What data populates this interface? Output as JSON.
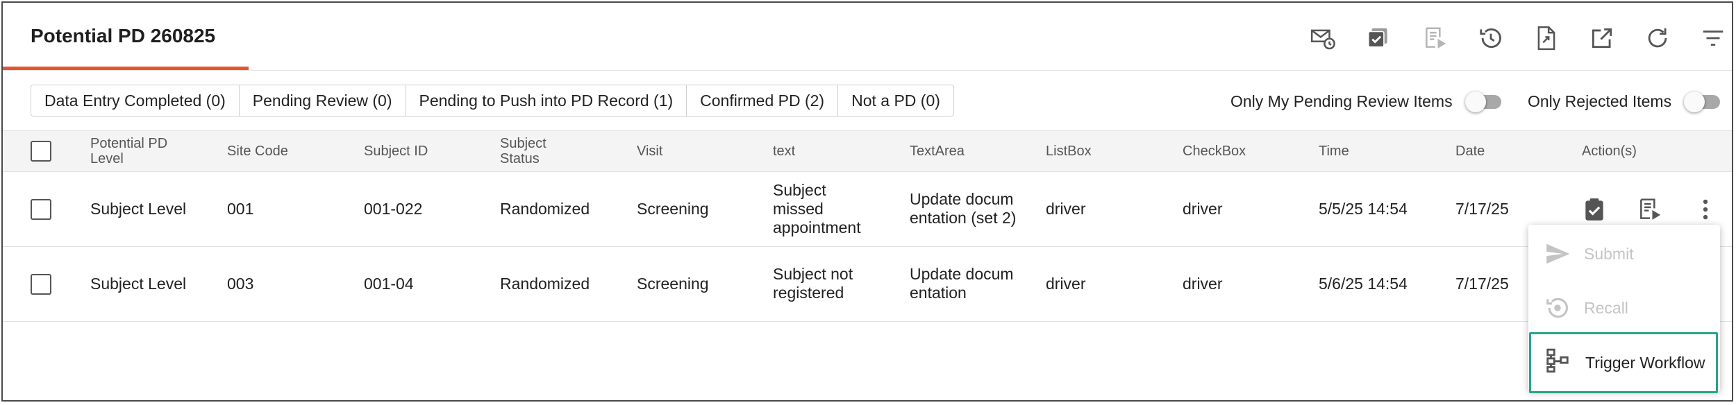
{
  "header": {
    "title": "Potential PD 260825",
    "tools": [
      {
        "icon": "email-schedule-icon"
      },
      {
        "icon": "bulk-approve-icon"
      },
      {
        "icon": "review-submit-icon"
      },
      {
        "icon": "history-icon"
      },
      {
        "icon": "export-document-icon"
      },
      {
        "icon": "open-external-icon"
      },
      {
        "icon": "refresh-icon"
      },
      {
        "icon": "filter-icon"
      }
    ]
  },
  "filters": {
    "segments": [
      "Data Entry Completed (0)",
      "Pending Review (0)",
      "Pending to Push into PD Record (1)",
      "Confirmed PD (2)",
      "Not a PD (0)"
    ],
    "toggle_my_pending": "Only My Pending Review Items",
    "toggle_rejected": "Only Rejected Items"
  },
  "table": {
    "columns": [
      "Potential PD Level",
      "Site Code",
      "Subject ID",
      "Subject Status",
      "Visit",
      "text",
      "TextArea",
      "ListBox",
      "CheckBox",
      "Time",
      "Date",
      "Action(s)"
    ],
    "rows": [
      {
        "level": "Subject Level",
        "site": "001",
        "subject_id": "001-022",
        "status": "Randomized",
        "visit": "Screening",
        "text": "Subject missed appointment",
        "textarea": "Update documentation (set 2)",
        "listbox": "driver",
        "checkbox": "driver",
        "time": "5/5/25 14:54",
        "date": "7/17/25"
      },
      {
        "level": "Subject Level",
        "site": "003",
        "subject_id": "001-04",
        "status": "Randomized",
        "visit": "Screening",
        "text": "Subject not registered",
        "textarea": "Update documentation",
        "listbox": "driver",
        "checkbox": "driver",
        "time": "5/6/25 14:54",
        "date": "7/17/25"
      }
    ]
  },
  "menu": {
    "items": [
      {
        "label": "Submit",
        "icon": "send-icon",
        "disabled": true
      },
      {
        "label": "Recall",
        "icon": "recall-icon",
        "disabled": true
      },
      {
        "label": "Trigger Workflow",
        "icon": "workflow-icon",
        "disabled": false
      }
    ]
  },
  "colors": {
    "accent": "#e8532b",
    "highlight_border": "#2aa389",
    "icon": "#555555",
    "icon_disabled": "#c4c4c4"
  }
}
